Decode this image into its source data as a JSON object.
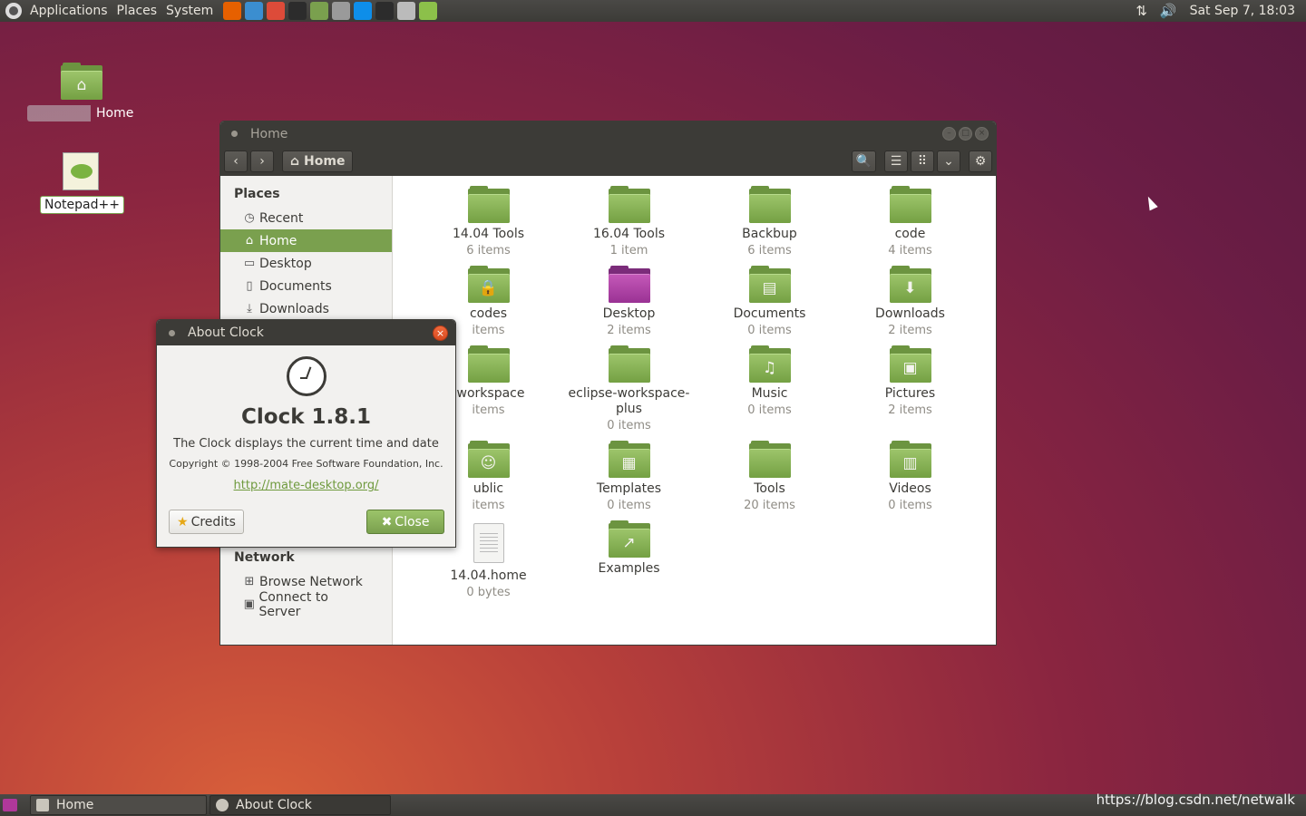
{
  "top_panel": {
    "menus": [
      "Applications",
      "Places",
      "System"
    ],
    "launchers": [
      {
        "icon": "firefox-icon",
        "color": "#e66000"
      },
      {
        "icon": "browser-icon",
        "color": "#3b8ed0"
      },
      {
        "icon": "chrome-icon",
        "color": "#dd4b39"
      },
      {
        "icon": "terminal-icon",
        "color": "#2c2c2c"
      },
      {
        "icon": "file-manager-icon",
        "color": "#7aa04e"
      },
      {
        "icon": "archive-icon",
        "color": "#9a9a9a"
      },
      {
        "icon": "teamviewer-icon",
        "color": "#0e8ee9"
      },
      {
        "icon": "terminal-icon",
        "color": "#2c2c2c"
      },
      {
        "icon": "network-icon",
        "color": "#bbbbbb"
      },
      {
        "icon": "text-editor-icon",
        "color": "#8cc04a"
      }
    ],
    "clock": "Sat Sep  7, 18:03"
  },
  "desktop_icons": [
    {
      "label": "Home",
      "icon": "home-folder-icon"
    },
    {
      "label": "Notepad++",
      "icon": "notepad-icon"
    }
  ],
  "file_manager": {
    "title": "Home",
    "path_button": "Home",
    "sidebar": {
      "places_heading": "Places",
      "places": [
        {
          "label": "Recent",
          "icon": "clock-icon"
        },
        {
          "label": "Home",
          "icon": "home-icon",
          "active": true
        },
        {
          "label": "Desktop",
          "icon": "desktop-icon"
        },
        {
          "label": "Documents",
          "icon": "document-icon"
        },
        {
          "label": "Downloads",
          "icon": "download-icon"
        }
      ],
      "network_heading": "Network",
      "network": [
        {
          "label": "Browse Network",
          "icon": "network-icon"
        },
        {
          "label": "Connect to Server",
          "icon": "server-icon"
        }
      ]
    },
    "items": [
      {
        "name": "14.04 Tools",
        "meta": "6 items",
        "kind": "folder"
      },
      {
        "name": "16.04 Tools",
        "meta": "1 item",
        "kind": "folder"
      },
      {
        "name": "Backbup",
        "meta": "6 items",
        "kind": "folder"
      },
      {
        "name": "code",
        "meta": "4 items",
        "kind": "folder"
      },
      {
        "name": "codes",
        "meta": "items",
        "kind": "folder-lock"
      },
      {
        "name": "Desktop",
        "meta": "2 items",
        "kind": "folder-desktop"
      },
      {
        "name": "Documents",
        "meta": "0 items",
        "kind": "folder-doc"
      },
      {
        "name": "Downloads",
        "meta": "2 items",
        "kind": "folder-download"
      },
      {
        "name": "-workspace",
        "meta": "items",
        "kind": "folder"
      },
      {
        "name": "eclipse-workspace-plus",
        "meta": "0 items",
        "kind": "folder"
      },
      {
        "name": "Music",
        "meta": "0 items",
        "kind": "folder-music"
      },
      {
        "name": "Pictures",
        "meta": "2 items",
        "kind": "folder-pictures"
      },
      {
        "name": "ublic",
        "meta": "items",
        "kind": "folder-public"
      },
      {
        "name": "Templates",
        "meta": "0 items",
        "kind": "folder-templates"
      },
      {
        "name": "Tools",
        "meta": "20 items",
        "kind": "folder"
      },
      {
        "name": "Videos",
        "meta": "0 items",
        "kind": "folder-videos"
      },
      {
        "name": "14.04.home",
        "meta": "0 bytes",
        "kind": "file"
      },
      {
        "name": "Examples",
        "meta": "",
        "kind": "folder-link"
      }
    ]
  },
  "about_dialog": {
    "title": "About Clock",
    "app_name": "Clock 1.8.1",
    "description": "The Clock displays the current time and date",
    "copyright": "Copyright © 1998-2004 Free Software Foundation, Inc.",
    "link": "http://mate-desktop.org/",
    "credits_label": "Credits",
    "close_label": "Close"
  },
  "bottom_panel": {
    "tasks": [
      {
        "label": "Home",
        "icon": "file-manager-icon"
      },
      {
        "label": "About Clock",
        "icon": "clock-icon"
      }
    ]
  },
  "watermark": "https://blog.csdn.net/netwalk",
  "colors": {
    "accent": "#7aa04e",
    "panel": "#3c3b37",
    "close": "#e0552a"
  }
}
